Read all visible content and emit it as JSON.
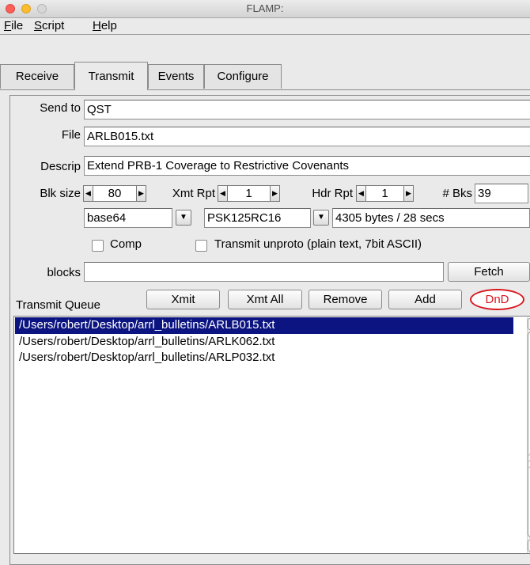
{
  "window": {
    "title": "FLAMP:"
  },
  "menu": [
    {
      "mnemonic": "F",
      "rest": "ile"
    },
    {
      "mnemonic": "S",
      "rest": "cript"
    },
    {
      "mnemonic": "H",
      "rest": "elp"
    }
  ],
  "tabs": [
    "Receive",
    "Transmit",
    "Events",
    "Configure"
  ],
  "active_tab": "Transmit",
  "form": {
    "send_to_label": "Send to",
    "send_to_value": "QST",
    "file_label": "File",
    "file_value": "ARLB015.txt",
    "descrip_label": "Descrip",
    "descrip_value": "Extend PRB-1 Coverage to Restrictive Covenants",
    "blk_size_label": "Blk size",
    "blk_size_value": "80",
    "xmt_rpt_label": "Xmt Rpt",
    "xmt_rpt_value": "1",
    "hdr_rpt_label": "Hdr Rpt",
    "hdr_rpt_value": "1",
    "bks_label": "# Bks",
    "bks_value": "39",
    "encoding_value": "base64",
    "mode_value": "PSK125RC16",
    "size_info": "4305 bytes / 28 secs",
    "comp_label": "Comp",
    "comp_checked": false,
    "unproto_label": "Transmit unproto (plain text, 7bit ASCII)",
    "unproto_checked": false,
    "blocks_label": "blocks",
    "blocks_value": "",
    "fetch_label": "Fetch"
  },
  "queue": {
    "label": "Transmit Queue",
    "buttons": {
      "xmit": "Xmit",
      "xmit_all": "Xmt All",
      "remove": "Remove",
      "add": "Add",
      "dnd": "DnD"
    },
    "items": [
      "/Users/robert/Desktop/arrl_bulletins/ARLB015.txt",
      "/Users/robert/Desktop/arrl_bulletins/ARLK062.txt",
      "/Users/robert/Desktop/arrl_bulletins/ARLP032.txt"
    ],
    "selected_index": 0
  },
  "colors": {
    "selection": "#0b1480",
    "dnd_accent": "#d8181e",
    "close_light": "#fc5f57",
    "min_light": "#fdbc2e"
  }
}
